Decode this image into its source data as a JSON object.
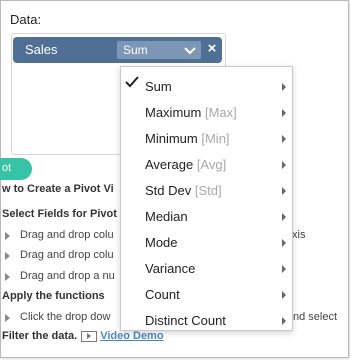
{
  "data_section": {
    "title": "Data:",
    "field": {
      "label": "Sales",
      "aggregation": "Sum",
      "close_glyph": "×"
    }
  },
  "pivot_button": {
    "label": "ot"
  },
  "help": {
    "heading": "w to Create a Pivot Vi",
    "step1_title": "Select Fields for Pivot",
    "step1_items": [
      "Drag and drop colu",
      "Drag and drop colu",
      "Drag and drop a nu"
    ],
    "right_fragment_1": "xis",
    "step2_title": "Apply the functions",
    "step2_item": "Click the drop dow",
    "right_fragment_2": "nd select",
    "filter_text": "Filter the data.",
    "video_link": "Video Demo"
  },
  "menu": {
    "items": [
      {
        "label": "Sum",
        "sub": "",
        "checked": true
      },
      {
        "label": "Maximum",
        "sub": "[Max]",
        "checked": false
      },
      {
        "label": "Minimum",
        "sub": "[Min]",
        "checked": false
      },
      {
        "label": "Average",
        "sub": "[Avg]",
        "checked": false
      },
      {
        "label": "Std Dev",
        "sub": "[Std]",
        "checked": false
      },
      {
        "label": "Median",
        "sub": "",
        "checked": false
      },
      {
        "label": "Mode",
        "sub": "",
        "checked": false
      },
      {
        "label": "Variance",
        "sub": "",
        "checked": false
      },
      {
        "label": "Count",
        "sub": "",
        "checked": false
      },
      {
        "label": "Distinct Count",
        "sub": "",
        "checked": false
      }
    ]
  },
  "icons": {
    "check": "checkmark-icon",
    "submenu": "chevron-right-icon",
    "dropdown": "chevron-down-icon",
    "close": "close-icon",
    "play": "play-icon",
    "expand": "triangle-right-icon"
  },
  "colors": {
    "pill": "#4f6f95",
    "select": "#7d96b5",
    "pivot_button": "#37c3a6",
    "link": "#4a86c7"
  }
}
